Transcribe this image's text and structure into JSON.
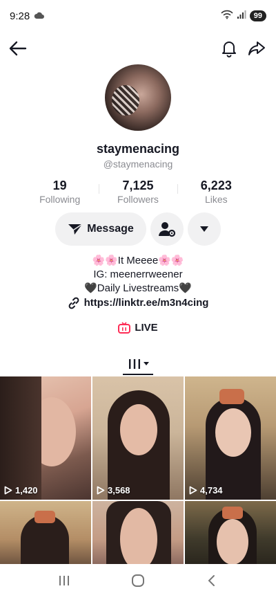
{
  "status": {
    "time": "9:28",
    "battery": "99"
  },
  "profile": {
    "username": "staymenacing",
    "handle": "@staymenacing",
    "stats": [
      {
        "value": "19",
        "label": "Following"
      },
      {
        "value": "7,125",
        "label": "Followers"
      },
      {
        "value": "6,223",
        "label": "Likes"
      }
    ],
    "message_label": "Message",
    "bio": {
      "line1": "🌸🌸It Meeee🌸🌸",
      "line2": "IG: meenerrweener",
      "line3": "🖤Daily Livestreams🖤",
      "link": "https://linktr.ee/m3n4cing"
    },
    "live_label": "LIVE"
  },
  "videos": [
    {
      "views": "1,420"
    },
    {
      "views": "3,568"
    },
    {
      "views": "4,734"
    },
    {
      "views": ""
    },
    {
      "views": ""
    },
    {
      "views": ""
    }
  ],
  "colors": {
    "primary_text": "#161823",
    "secondary_text": "#8a8b91",
    "button_bg": "#f1f1f2",
    "live_accent": "#fe2c55"
  },
  "icons": {
    "back": "arrow-left-icon",
    "bell": "bell-icon",
    "share": "share-icon",
    "message": "send-icon",
    "manage": "user-gear-icon",
    "more": "caret-down-icon",
    "link": "link-icon",
    "live": "live-tv-icon",
    "grid": "grid-bars-icon",
    "play": "play-icon"
  }
}
